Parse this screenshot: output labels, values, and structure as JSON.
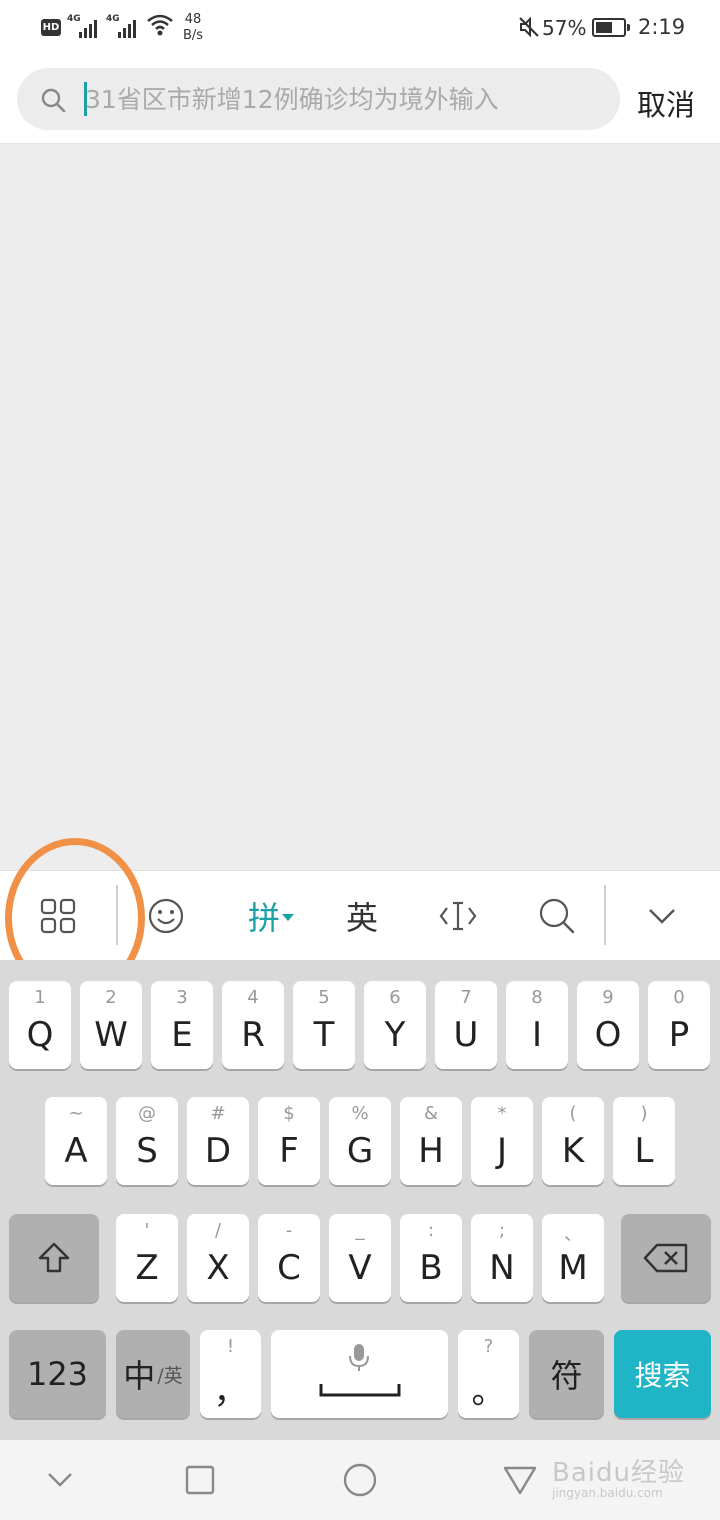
{
  "status_bar": {
    "hd": "HD",
    "network_1": "4G",
    "network_2": "4G",
    "speed_value": "48",
    "speed_unit": "B/s",
    "battery_percent": "57%",
    "time": "2:19"
  },
  "search": {
    "placeholder": "31省区市新增12例确诊均为境外输入",
    "value": "",
    "cancel_label": "取消"
  },
  "keyboard_toolbar": {
    "pinyin_label": "拼",
    "english_label": "英",
    "items": [
      "grid-menu-icon",
      "emoji-icon",
      "pinyin-mode",
      "english-mode",
      "cursor-icon",
      "search-icon",
      "collapse-icon"
    ]
  },
  "keyboard": {
    "row1": [
      {
        "hint": "1",
        "key": "Q"
      },
      {
        "hint": "2",
        "key": "W"
      },
      {
        "hint": "3",
        "key": "E"
      },
      {
        "hint": "4",
        "key": "R"
      },
      {
        "hint": "5",
        "key": "T"
      },
      {
        "hint": "6",
        "key": "Y"
      },
      {
        "hint": "7",
        "key": "U"
      },
      {
        "hint": "8",
        "key": "I"
      },
      {
        "hint": "9",
        "key": "O"
      },
      {
        "hint": "0",
        "key": "P"
      }
    ],
    "row2": [
      {
        "hint": "~",
        "key": "A"
      },
      {
        "hint": "@",
        "key": "S"
      },
      {
        "hint": "#",
        "key": "D"
      },
      {
        "hint": "$",
        "key": "F"
      },
      {
        "hint": "%",
        "key": "G"
      },
      {
        "hint": "&",
        "key": "H"
      },
      {
        "hint": "*",
        "key": "J"
      },
      {
        "hint": "(",
        "key": "K"
      },
      {
        "hint": ")",
        "key": "L"
      }
    ],
    "row3": [
      {
        "hint": "'",
        "key": "Z"
      },
      {
        "hint": "/",
        "key": "X"
      },
      {
        "hint": "-",
        "key": "C"
      },
      {
        "hint": "_",
        "key": "V"
      },
      {
        "hint": ":",
        "key": "B"
      },
      {
        "hint": ";",
        "key": "N"
      },
      {
        "hint": "、",
        "key": "M"
      }
    ],
    "num_label": "123",
    "lang_main": "中",
    "lang_sub": "/英",
    "comma_hint": "!",
    "comma_key": "，",
    "period_hint": "?",
    "period_key": "。",
    "symbol_label": "符",
    "search_label": "搜索"
  },
  "watermark": {
    "main": "Baidu经验",
    "sub": "jingyan.baidu.com"
  },
  "colors": {
    "accent": "#1aa0a5",
    "search_key": "#1fb5c6",
    "annotation": "#f19147"
  }
}
